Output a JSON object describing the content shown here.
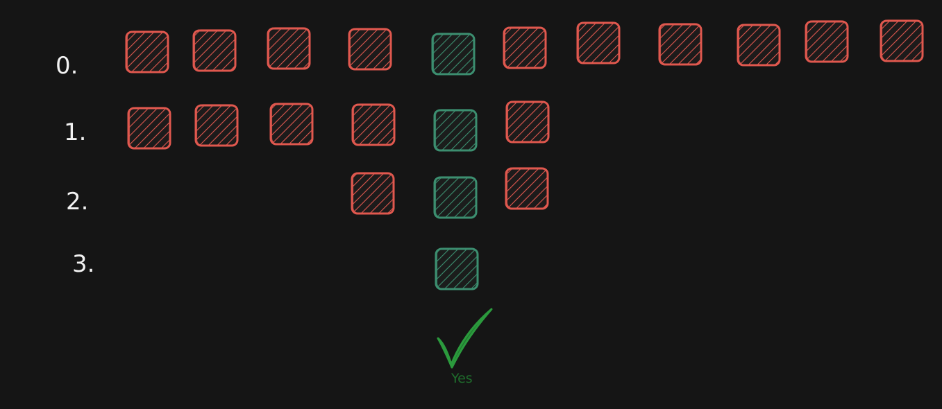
{
  "colors": {
    "background": "#151515",
    "red": "#e0584f",
    "green": "#3c8f70",
    "check": "#1f7a2e",
    "label": "#f2f2f2"
  },
  "rows": [
    {
      "label": "0.",
      "cells": [
        "red",
        "red",
        "red",
        "red",
        "green",
        "red",
        "red",
        "red",
        "red",
        "red",
        "red"
      ]
    },
    {
      "label": "1.",
      "cells": [
        "red",
        "red",
        "red",
        "red",
        "green",
        "red"
      ]
    },
    {
      "label": "2.",
      "cells": [
        "red",
        "green",
        "red"
      ]
    },
    {
      "label": "3.",
      "cells": [
        "green"
      ]
    }
  ],
  "result": {
    "icon": "checkmark-icon",
    "label": "Yes"
  }
}
